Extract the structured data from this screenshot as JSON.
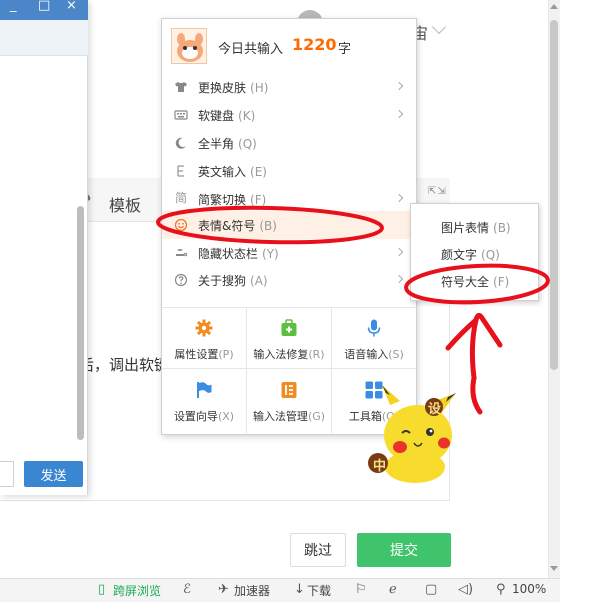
{
  "background": {
    "top_partial_text": "宙",
    "template_label": "模板",
    "body_text_partial": "后，调出软键",
    "body_text_tail": "。",
    "skip_button": "跳过",
    "submit_button": "提交",
    "colors": {
      "submit": "#3fc36b"
    }
  },
  "chat_window": {
    "title_controls": [
      "_",
      "□",
      "×"
    ],
    "send_button": "发送"
  },
  "ime_menu": {
    "today_label": "今日共输入",
    "today_count": "1220",
    "today_unit": "字",
    "items": [
      {
        "label": "更换皮肤",
        "key": "(H)",
        "icon": "tshirt-icon",
        "has_submenu": true
      },
      {
        "label": "软键盘",
        "key": "(K)",
        "icon": "keyboard-icon",
        "has_submenu": true
      },
      {
        "label": "全半角",
        "key": "(Q)",
        "icon": "moon-icon",
        "has_submenu": false
      },
      {
        "label": "英文输入",
        "key": "(E)",
        "icon": "letter-e-icon",
        "has_submenu": false
      },
      {
        "label": "简繁切换",
        "key": "(F)",
        "icon": "jian-icon",
        "has_submenu": true
      },
      {
        "label": "表情&符号",
        "key": "(B)",
        "icon": "smiley-icon",
        "has_submenu": true
      },
      {
        "label": "隐藏状态栏",
        "key": "(Y)",
        "icon": "hide-statusbar-icon",
        "has_submenu": true
      },
      {
        "label": "关于搜狗",
        "key": "(A)",
        "icon": "question-icon",
        "has_submenu": true
      }
    ],
    "tools": [
      {
        "label": "属性设置",
        "key": "(P)",
        "icon": "gear-icon",
        "color": "#f08c22"
      },
      {
        "label": "输入法修复",
        "key": "(R)",
        "icon": "repair-kit-icon",
        "color": "#5cbf3f"
      },
      {
        "label": "语音输入",
        "key": "(S)",
        "icon": "microphone-icon",
        "color": "#3a8de0"
      },
      {
        "label": "设置向导",
        "key": "(X)",
        "icon": "flag-icon",
        "color": "#3a8de0"
      },
      {
        "label": "输入法管理",
        "key": "(G)",
        "icon": "manage-icon",
        "color": "#f08c22"
      },
      {
        "label": "工具箱",
        "key": "(O)",
        "icon": "grid-icon",
        "color": "#3a8de0"
      }
    ],
    "colors": {
      "count": "#ff6a00",
      "active_row": "#fff0e6"
    }
  },
  "submenu": {
    "items": [
      {
        "label": "图片表情",
        "key": "(B)"
      },
      {
        "label": "颜文字",
        "key": "(Q)"
      },
      {
        "label": "符号大全",
        "key": "(F)"
      }
    ]
  },
  "annotations": {
    "color": "#e8101a"
  },
  "sticker_chars": [
    "设",
    "中"
  ],
  "statusbar": {
    "split_view": "跨屏浏览",
    "accelerator": "加速器",
    "download": "下载",
    "zoom": "100%",
    "colors": {
      "split_view": "#1aaa55"
    }
  }
}
